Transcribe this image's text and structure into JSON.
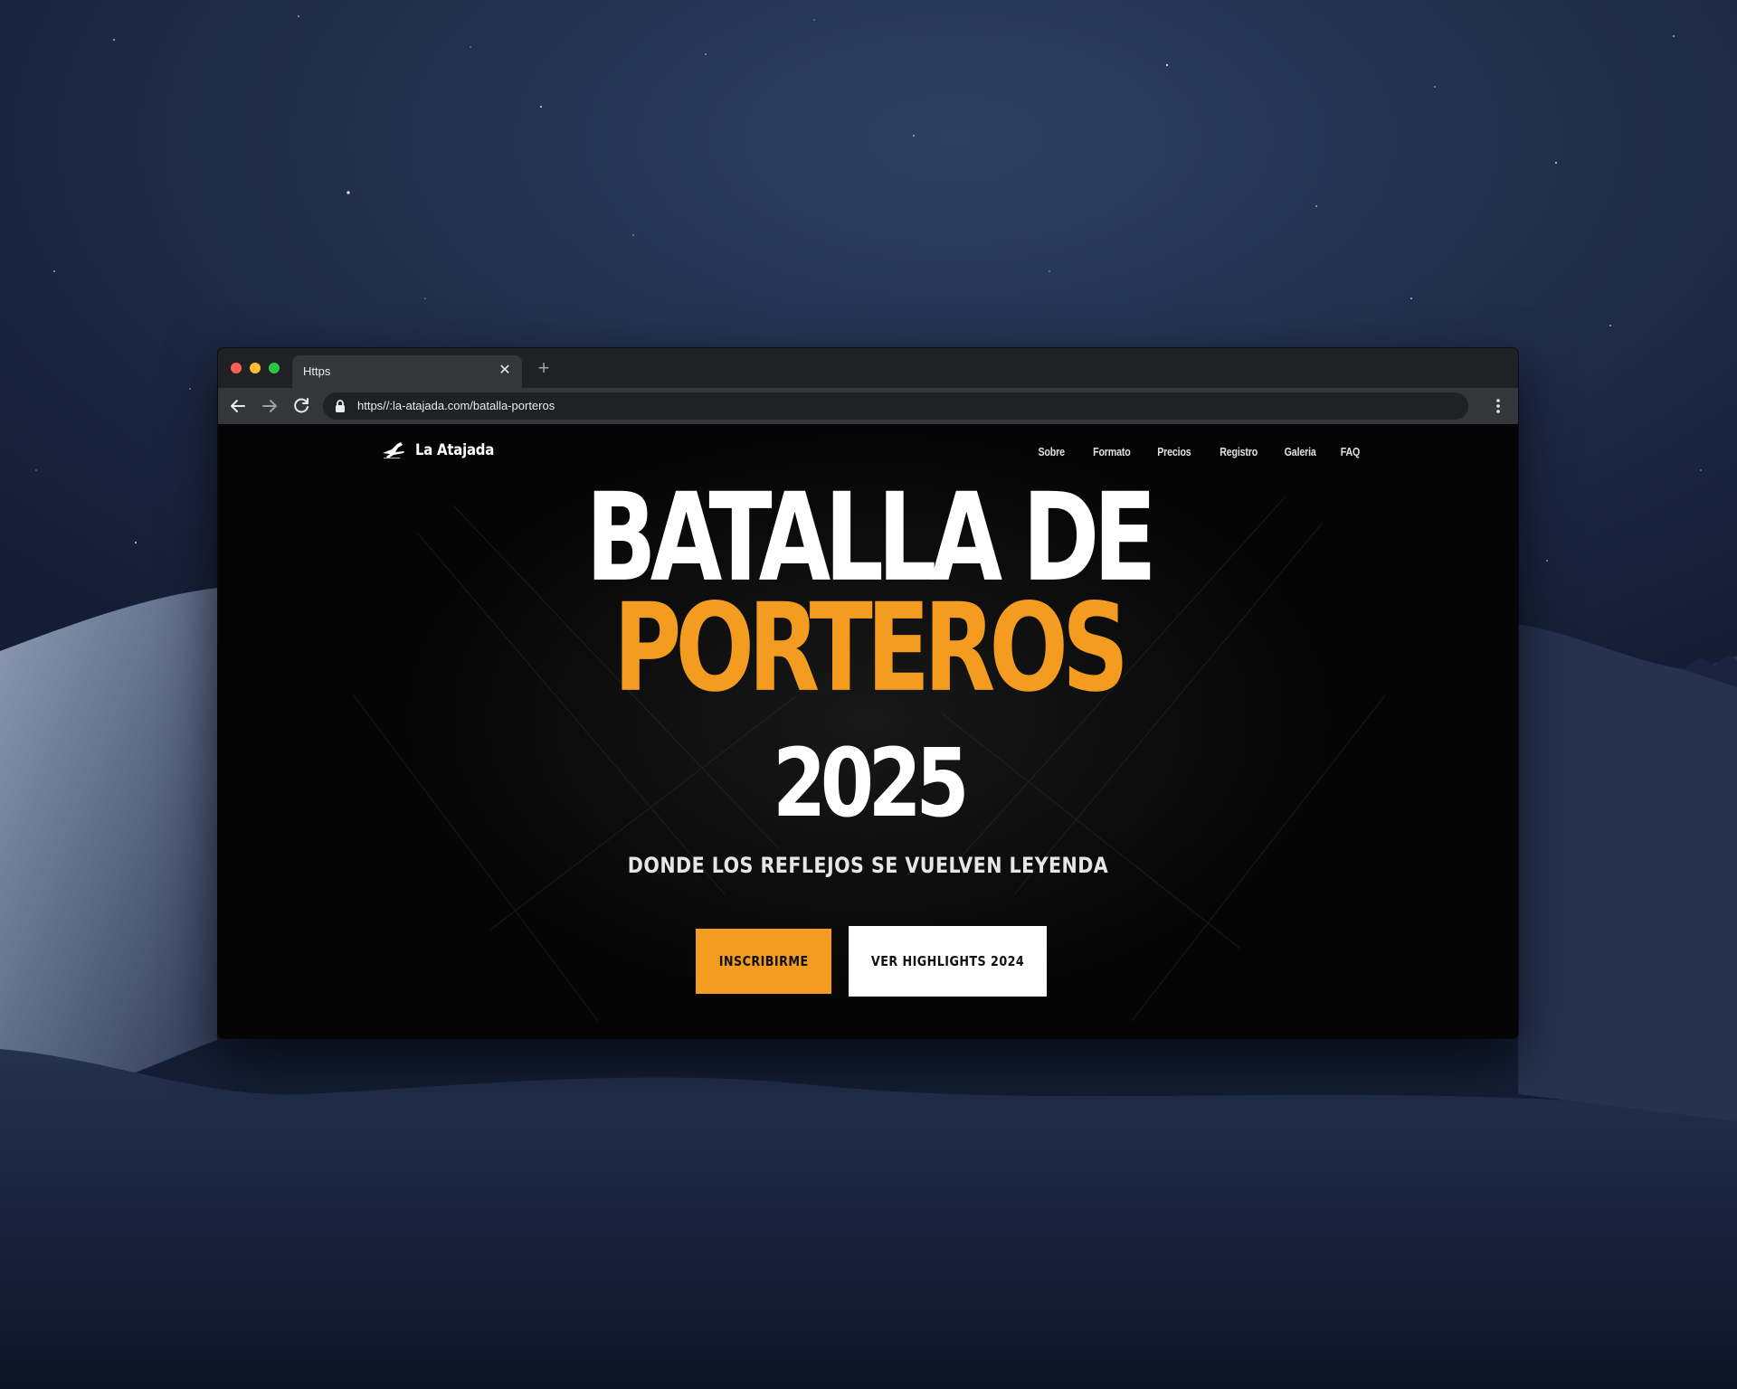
{
  "browser": {
    "tab_title": "Https",
    "tab_close": "✕",
    "new_tab": "+",
    "url": "https//:la-atajada.com/batalla-porteros"
  },
  "site": {
    "logo_text": "La Atajada",
    "nav": [
      "Sobre",
      "Formato",
      "Precios",
      "Registro",
      "Galeria",
      "FAQ"
    ]
  },
  "hero": {
    "line1": "BATALLA DE",
    "line2": "PORTEROS",
    "line3": "2025",
    "subtitle": "DONDE LOS REFLEJOS SE VUELVEN LEYENDA",
    "primary_button": "INSCRIBIRME",
    "secondary_button": "VER HIGHLIGHTS 2024"
  },
  "colors": {
    "accent": "#f39c1f",
    "page_background": "#050505",
    "browser_chrome": "#202124"
  },
  "icons": [
    "back-arrow-icon",
    "forward-arrow-icon",
    "reload-icon",
    "lock-icon",
    "menu-dots-icon",
    "goalkeeper-logo-icon"
  ]
}
